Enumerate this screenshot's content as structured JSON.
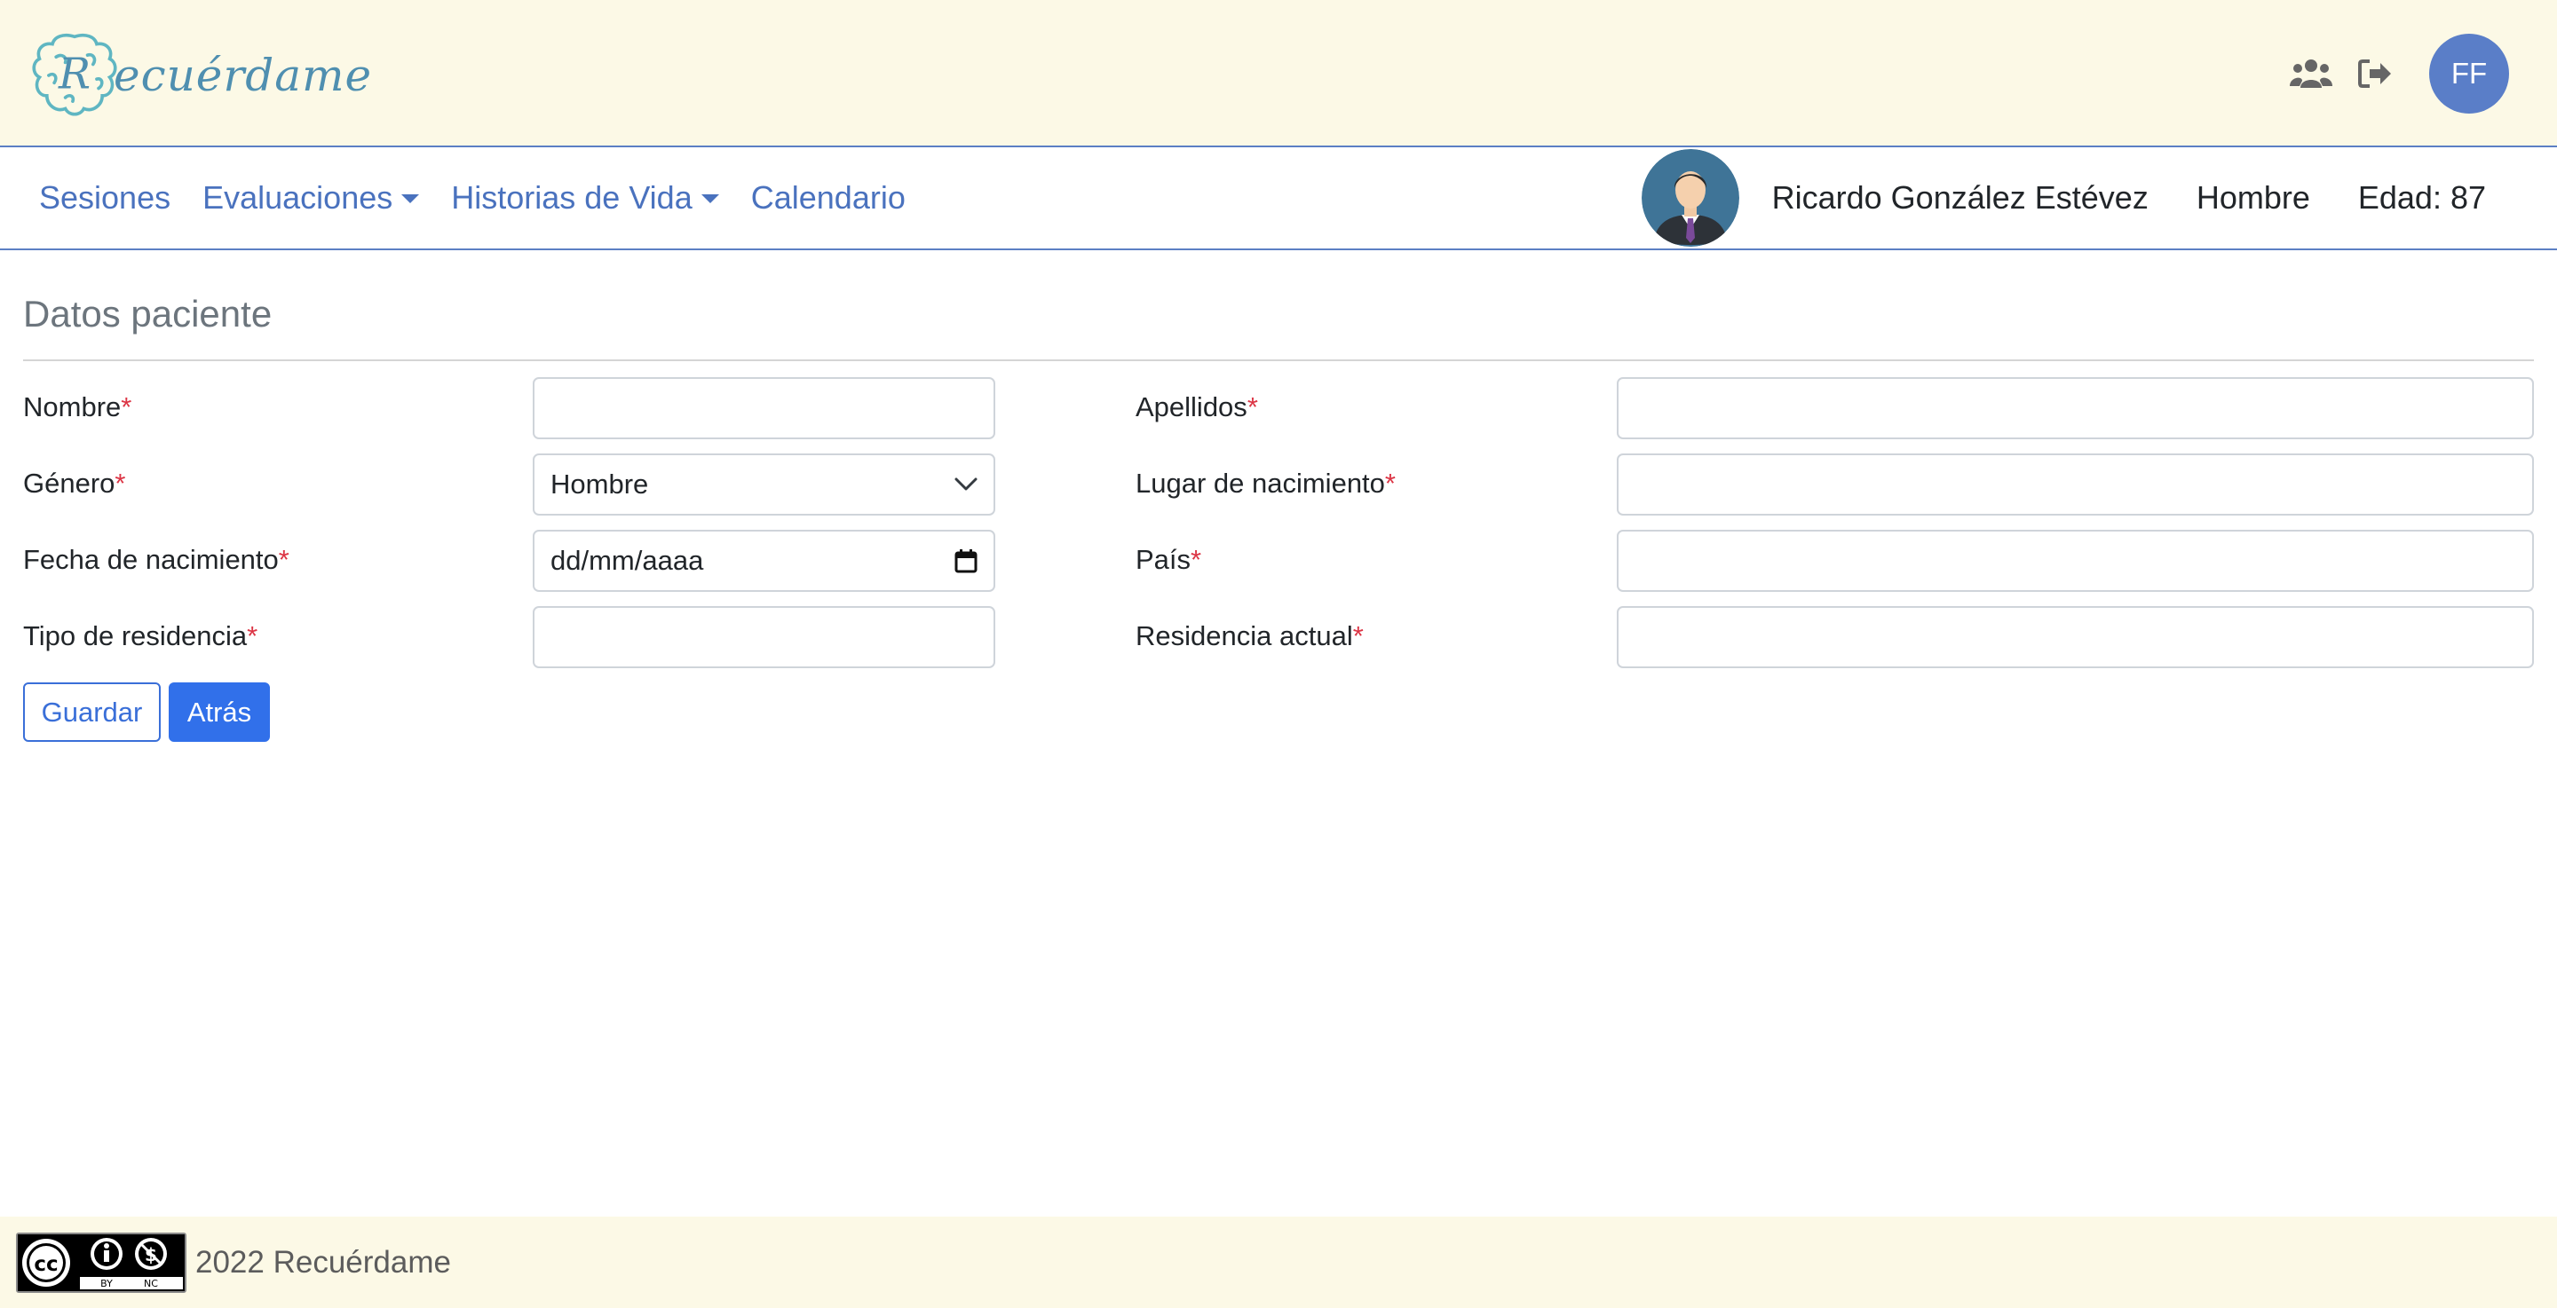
{
  "app": {
    "logo_text": "ecuérdame",
    "logo_initial": "R"
  },
  "header": {
    "icons": [
      "users-icon",
      "logout-icon"
    ],
    "user_initials": "FF",
    "avatar_color": "#5a7ec8"
  },
  "nav": {
    "items": [
      {
        "label": "Sesiones",
        "dropdown": false
      },
      {
        "label": "Evaluaciones",
        "dropdown": true
      },
      {
        "label": "Historias de Vida",
        "dropdown": true
      },
      {
        "label": "Calendario",
        "dropdown": false
      }
    ],
    "link_color": "#4a72be"
  },
  "patient": {
    "name": "Ricardo González Estévez",
    "gender": "Hombre",
    "age": "Edad: 87"
  },
  "form": {
    "title": "Datos paciente",
    "required_marker": "*",
    "fields": {
      "nombre": {
        "label": "Nombre",
        "value": ""
      },
      "apellidos": {
        "label": "Apellidos",
        "value": ""
      },
      "genero": {
        "label": "Género",
        "value": "Hombre"
      },
      "lugar_nacimiento": {
        "label": "Lugar de nacimiento",
        "value": ""
      },
      "fecha_nacimiento": {
        "label": "Fecha de nacimiento",
        "value": "dd/mm/aaaa"
      },
      "pais": {
        "label": "País",
        "value": ""
      },
      "tipo_residencia": {
        "label": "Tipo de residencia",
        "value": ""
      },
      "residencia_actual": {
        "label": "Residencia actual",
        "value": ""
      }
    },
    "buttons": {
      "save": "Guardar",
      "back": "Atrás"
    },
    "primary_color": "#3170ea"
  },
  "footer": {
    "text": "2022 Recuérdame",
    "license_badge": {
      "by": "BY",
      "nc": "NC"
    },
    "background": "#fcf9e6"
  }
}
